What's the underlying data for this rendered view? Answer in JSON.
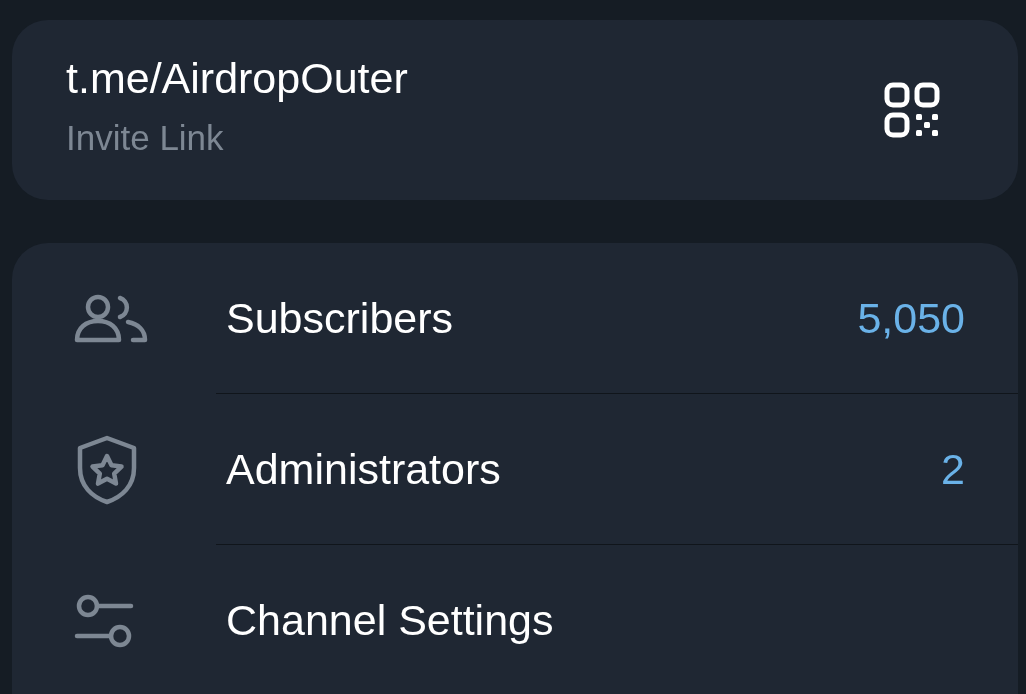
{
  "invite": {
    "link": "t.me/AirdropOuter",
    "label": "Invite Link"
  },
  "rows": [
    {
      "kind": "people",
      "label": "Subscribers",
      "value": "5,050"
    },
    {
      "kind": "shield",
      "label": "Administrators",
      "value": "2"
    },
    {
      "kind": "sliders",
      "label": "Channel Settings"
    }
  ]
}
